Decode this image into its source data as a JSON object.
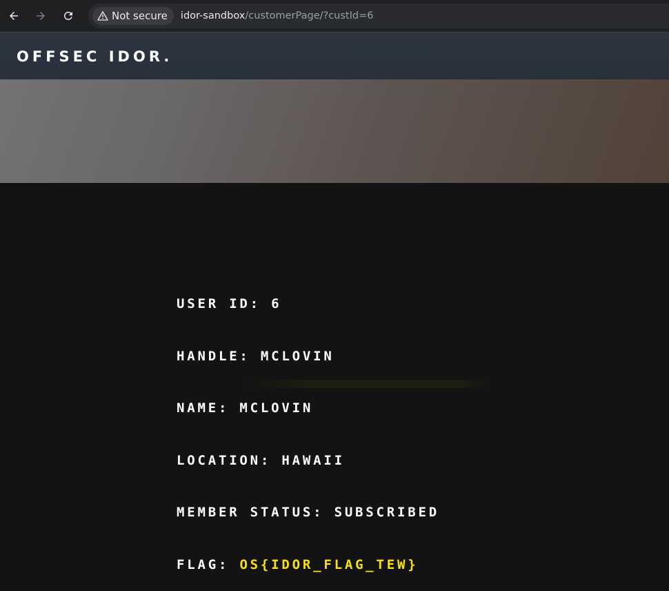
{
  "browser": {
    "security_label": "Not secure",
    "url_host": "idor-sandbox",
    "url_path": "/customerPage/?custId=6",
    "icons": [
      "back-arrow-icon",
      "forward-arrow-icon",
      "reload-icon",
      "warning-icon"
    ]
  },
  "site": {
    "brand": "OFFSEC IDOR."
  },
  "profile": {
    "user_id": "USER ID: 6",
    "handle": "HANDLE: MCLOVIN",
    "name": "NAME: MCLOVIN",
    "location": "LOCATION: HAWAII",
    "member_status": "MEMBER STATUS: SUBSCRIBED",
    "flag_label": "FLAG: ",
    "flag_value": "OS{IDOR_FLAG_TEW}"
  },
  "colors": {
    "page_bg": "#131313",
    "header_bg": "#2c3540",
    "flag": "#f5e211",
    "text": "#ffffff"
  }
}
